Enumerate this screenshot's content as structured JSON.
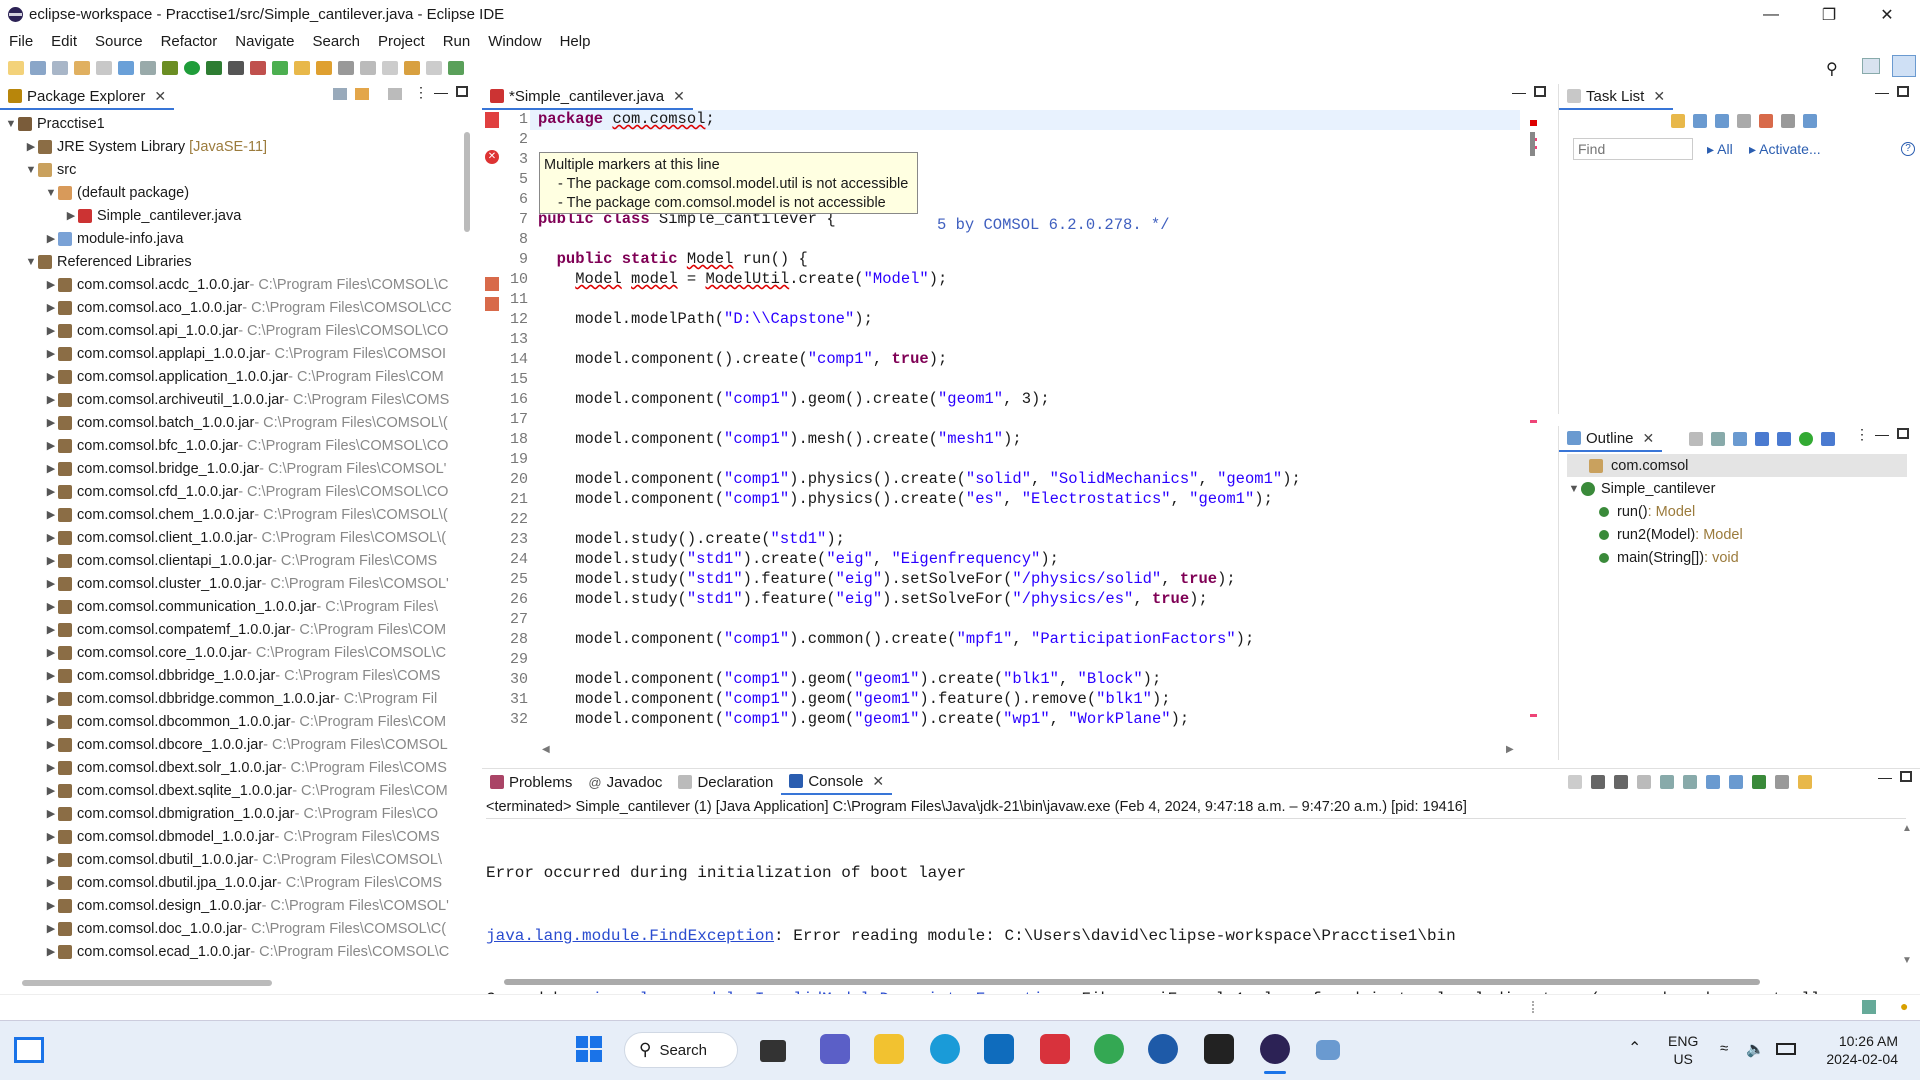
{
  "window": {
    "title": "eclipse-workspace - Pracctise1/src/Simple_cantilever.java - Eclipse IDE"
  },
  "menu": [
    "File",
    "Edit",
    "Source",
    "Refactor",
    "Navigate",
    "Search",
    "Project",
    "Run",
    "Window",
    "Help"
  ],
  "package_explorer": {
    "title": "Package Explorer",
    "project": "Pracctise1",
    "jre": "JRE System Library",
    "jre_version": "[JavaSE-11]",
    "src": "src",
    "default_pkg": "(default package)",
    "file": "Simple_cantilever.java",
    "module_info": "module-info.java",
    "ref_libs": "Referenced Libraries",
    "jars": [
      {
        "name": "com.comsol.acdc_1.0.0.jar",
        "path": " - C:\\Program Files\\COMSOL\\C"
      },
      {
        "name": "com.comsol.aco_1.0.0.jar",
        "path": " - C:\\Program Files\\COMSOL\\CC"
      },
      {
        "name": "com.comsol.api_1.0.0.jar",
        "path": " - C:\\Program Files\\COMSOL\\CO"
      },
      {
        "name": "com.comsol.applapi_1.0.0.jar",
        "path": " - C:\\Program Files\\COMSOI"
      },
      {
        "name": "com.comsol.application_1.0.0.jar",
        "path": " - C:\\Program Files\\COM"
      },
      {
        "name": "com.comsol.archiveutil_1.0.0.jar",
        "path": " - C:\\Program Files\\COMS"
      },
      {
        "name": "com.comsol.batch_1.0.0.jar",
        "path": " - C:\\Program Files\\COMSOL\\("
      },
      {
        "name": "com.comsol.bfc_1.0.0.jar",
        "path": " - C:\\Program Files\\COMSOL\\CO"
      },
      {
        "name": "com.comsol.bridge_1.0.0.jar",
        "path": " - C:\\Program Files\\COMSOL'"
      },
      {
        "name": "com.comsol.cfd_1.0.0.jar",
        "path": " - C:\\Program Files\\COMSOL\\CO"
      },
      {
        "name": "com.comsol.chem_1.0.0.jar",
        "path": " - C:\\Program Files\\COMSOL\\("
      },
      {
        "name": "com.comsol.client_1.0.0.jar",
        "path": " - C:\\Program Files\\COMSOL\\("
      },
      {
        "name": "com.comsol.clientapi_1.0.0.jar",
        "path": " - C:\\Program Files\\COMS"
      },
      {
        "name": "com.comsol.cluster_1.0.0.jar",
        "path": " - C:\\Program Files\\COMSOL'"
      },
      {
        "name": "com.comsol.communication_1.0.0.jar",
        "path": " - C:\\Program Files\\"
      },
      {
        "name": "com.comsol.compatemf_1.0.0.jar",
        "path": " - C:\\Program Files\\COM"
      },
      {
        "name": "com.comsol.core_1.0.0.jar",
        "path": " - C:\\Program Files\\COMSOL\\C"
      },
      {
        "name": "com.comsol.dbbridge_1.0.0.jar",
        "path": " - C:\\Program Files\\COMS"
      },
      {
        "name": "com.comsol.dbbridge.common_1.0.0.jar",
        "path": " - C:\\Program Fil"
      },
      {
        "name": "com.comsol.dbcommon_1.0.0.jar",
        "path": " - C:\\Program Files\\COM"
      },
      {
        "name": "com.comsol.dbcore_1.0.0.jar",
        "path": " - C:\\Program Files\\COMSOL"
      },
      {
        "name": "com.comsol.dbext.solr_1.0.0.jar",
        "path": " - C:\\Program Files\\COMS"
      },
      {
        "name": "com.comsol.dbext.sqlite_1.0.0.jar",
        "path": " - C:\\Program Files\\COM"
      },
      {
        "name": "com.comsol.dbmigration_1.0.0.jar",
        "path": " - C:\\Program Files\\CO"
      },
      {
        "name": "com.comsol.dbmodel_1.0.0.jar",
        "path": " - C:\\Program Files\\COMS"
      },
      {
        "name": "com.comsol.dbutil_1.0.0.jar",
        "path": " - C:\\Program Files\\COMSOL\\"
      },
      {
        "name": "com.comsol.dbutil.jpa_1.0.0.jar",
        "path": " - C:\\Program Files\\COMS"
      },
      {
        "name": "com.comsol.design_1.0.0.jar",
        "path": " - C:\\Program Files\\COMSOL'"
      },
      {
        "name": "com.comsol.doc_1.0.0.jar",
        "path": " - C:\\Program Files\\COMSOL\\C("
      },
      {
        "name": "com.comsol.ecad_1.0.0.jar",
        "path": " - C:\\Program Files\\COMSOL\\C"
      }
    ]
  },
  "editor": {
    "tab": "*Simple_cantilever.java",
    "tooltip": {
      "title": "Multiple markers at this line",
      "line1": "- The package com.comsol.model.util is not accessible",
      "line2": "- The package com.comsol.model is not accessible"
    },
    "line_numbers": [
      "1",
      "2",
      "3",
      "5",
      "6",
      "7",
      "8",
      "9",
      "10",
      "11",
      "12",
      "13",
      "14",
      "15",
      "16",
      "17",
      "18",
      "19",
      "20",
      "21",
      "22",
      "23",
      "24",
      "25",
      "26",
      "27",
      "28",
      "29",
      "30",
      "31",
      "32"
    ],
    "comment_tail": "5 by COMSOL 6.2.0.278. */"
  },
  "task_list": {
    "title": "Task List",
    "find_placeholder": "Find",
    "all": "All",
    "activate": "Activate..."
  },
  "outline": {
    "title": "Outline",
    "package": "com.comsol",
    "class": "Simple_cantilever",
    "methods": [
      {
        "name": "run()",
        "type": " : Model"
      },
      {
        "name": "run2(Model)",
        "type": " : Model"
      },
      {
        "name": "main(String[])",
        "type": " : void"
      }
    ]
  },
  "bottom_tabs": [
    "Problems",
    "Javadoc",
    "Declaration",
    "Console"
  ],
  "console": {
    "header": "<terminated> Simple_cantilever (1) [Java Application] C:\\Program Files\\Java\\jdk-21\\bin\\javaw.exe  (Feb 4, 2024, 9:47:18 a.m. – 9:47:20 a.m.) [pid: 19416]",
    "line1": "Error occurred during initialization of boot layer",
    "line2_link": "java.lang.module.FindException",
    "line2_rest": ": Error reading module: C:\\Users\\david\\eclipse-workspace\\Pracctise1\\bin",
    "line3_pre": "Caused by: ",
    "line3_link": "java.lang.module.InvalidModuleDescriptorException",
    "line3_rest": ": FibonacciExample1.class found in top-level directory (unnamed package not allow"
  },
  "taskbar": {
    "search": "Search",
    "lang1": "ENG",
    "lang2": "US",
    "time": "10:26 AM",
    "date": "2024-02-04"
  },
  "colors": {
    "accent": "#3875d7",
    "keyword": "#7f0055",
    "string": "#2a00ff",
    "error": "#d00000"
  }
}
